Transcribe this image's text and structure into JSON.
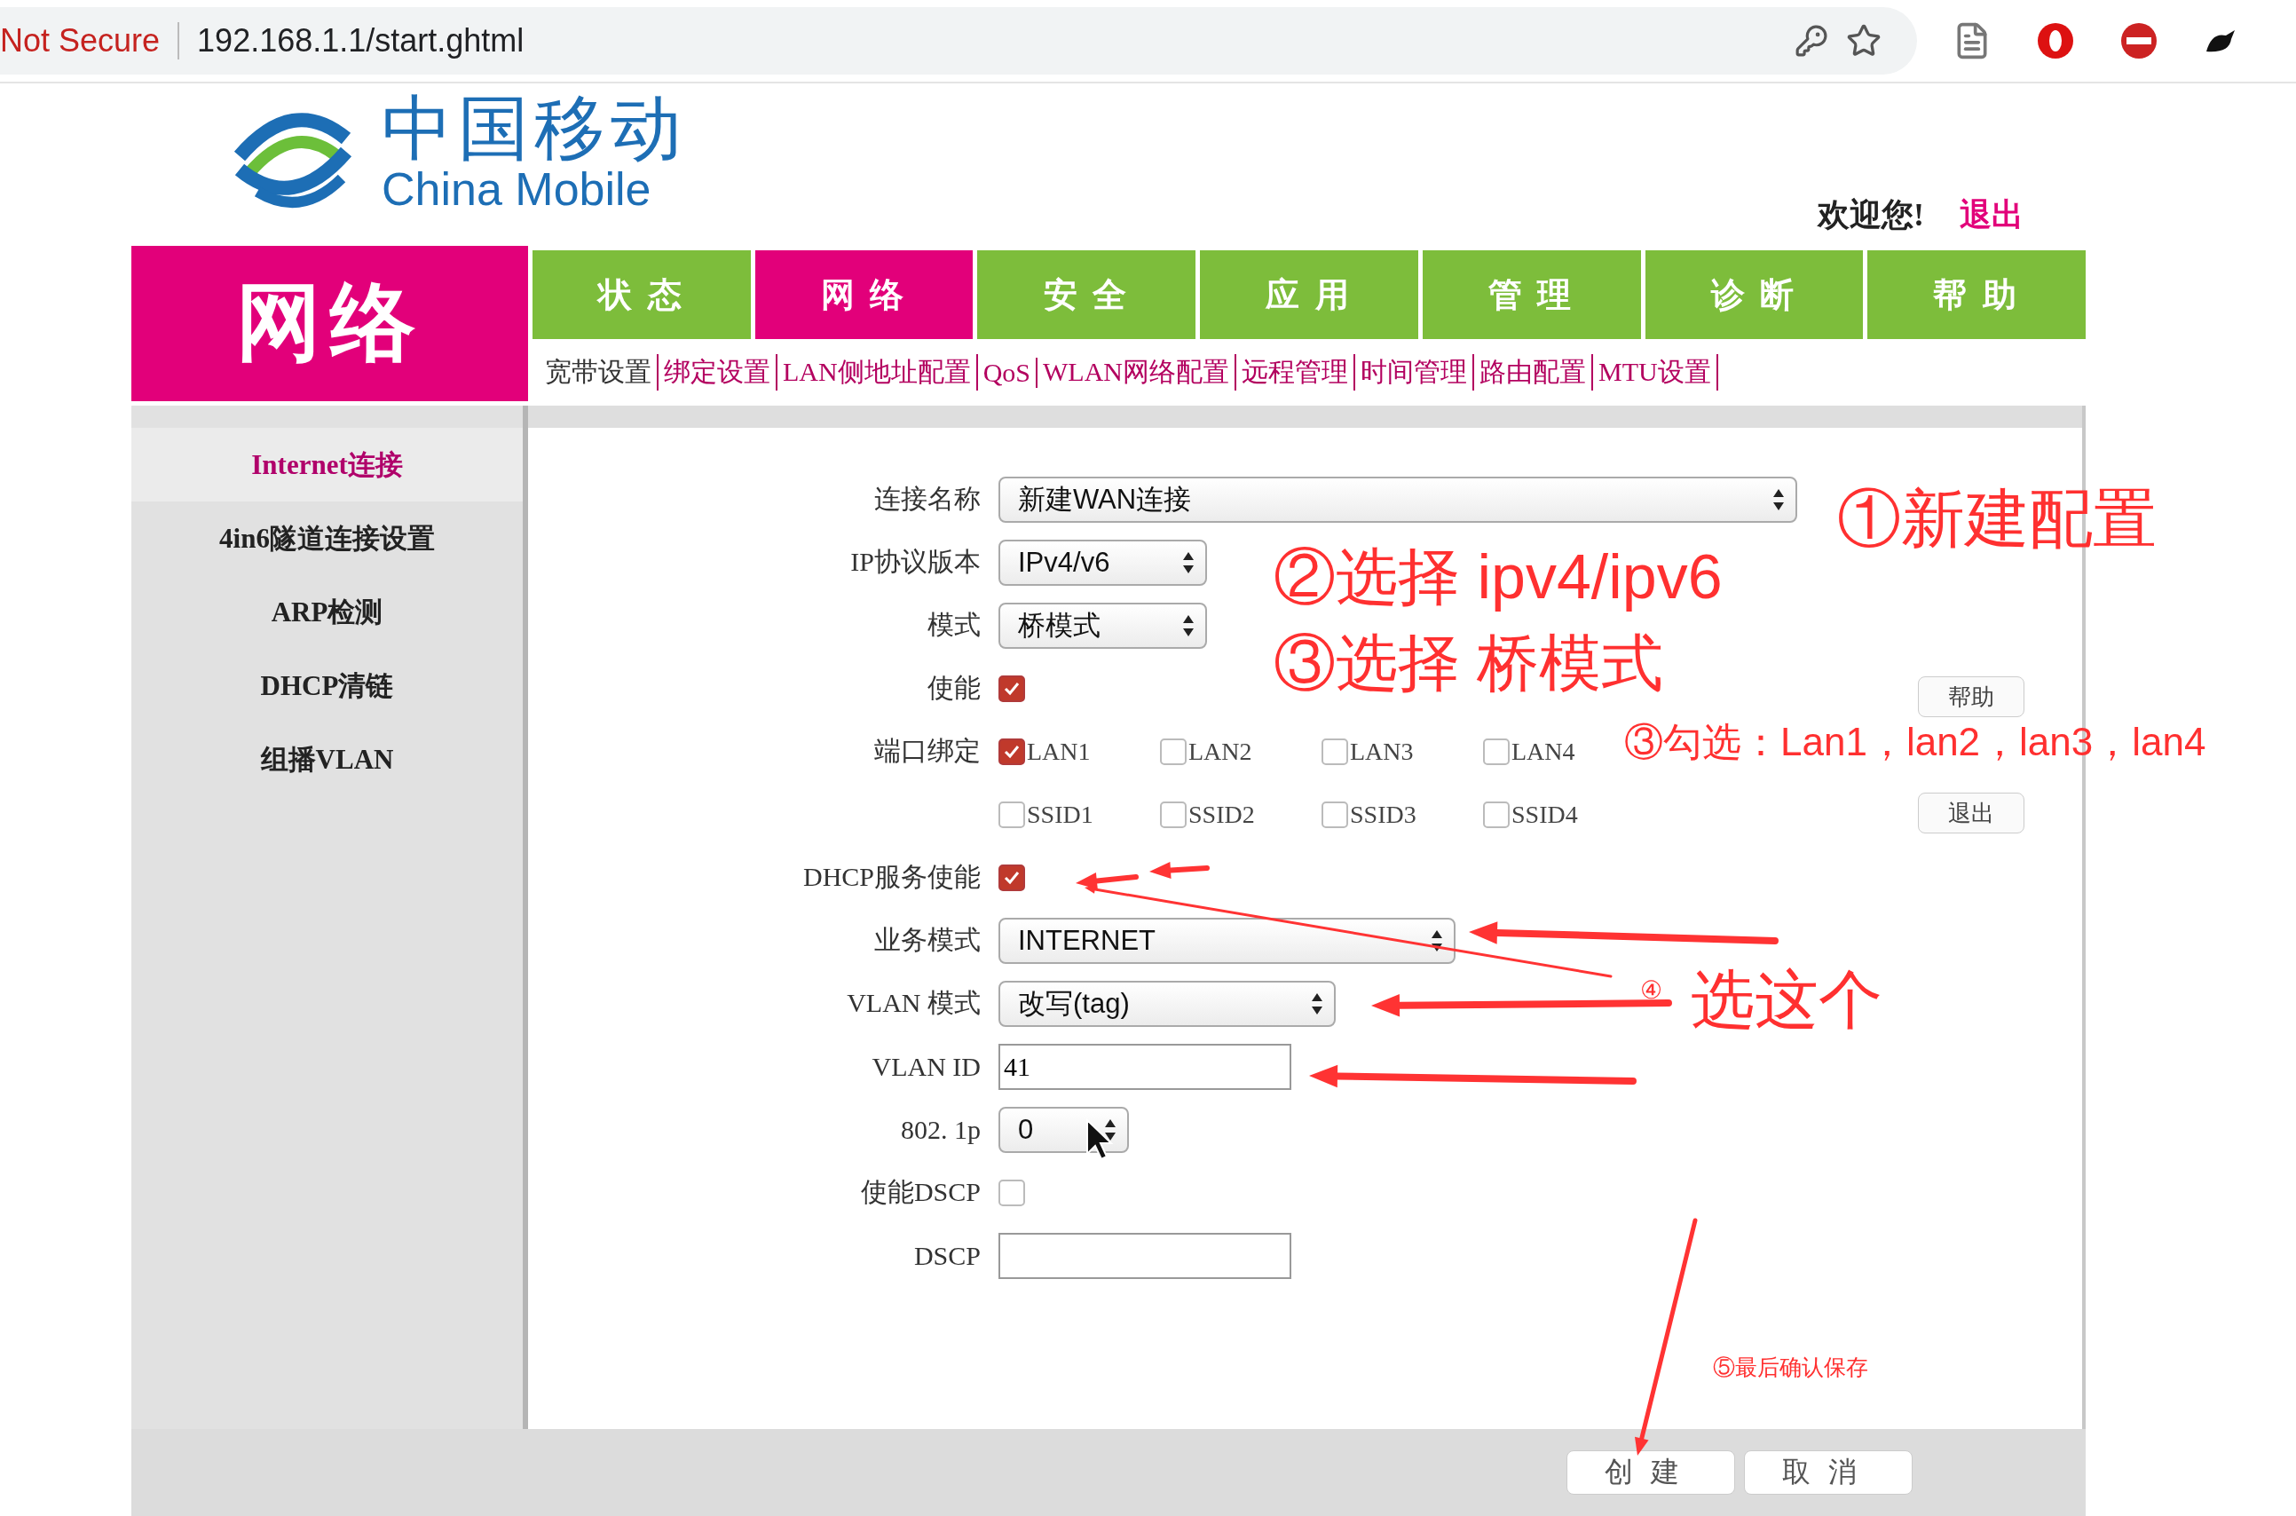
{
  "browser": {
    "security": "Not Secure",
    "url": "192.168.1.1/start.ghtml"
  },
  "logo": {
    "cn": "中国移动",
    "en": "China Mobile"
  },
  "welcome": {
    "text": "欢迎您!",
    "logout": "退出"
  },
  "section_title": "网络",
  "tabs": [
    {
      "label": "状 态",
      "selected": false
    },
    {
      "label": "网 络",
      "selected": true
    },
    {
      "label": "安 全",
      "selected": false
    },
    {
      "label": "应 用",
      "selected": false
    },
    {
      "label": "管 理",
      "selected": false
    },
    {
      "label": "诊 断",
      "selected": false
    },
    {
      "label": "帮 助",
      "selected": false
    }
  ],
  "submenu": [
    {
      "label": "宽带设置",
      "selected": true
    },
    {
      "label": "绑定设置",
      "selected": false
    },
    {
      "label": "LAN侧地址配置",
      "selected": false
    },
    {
      "label": "QoS",
      "selected": false
    },
    {
      "label": "WLAN网络配置",
      "selected": false
    },
    {
      "label": "远程管理",
      "selected": false
    },
    {
      "label": "时间管理",
      "selected": false
    },
    {
      "label": "路由配置",
      "selected": false
    },
    {
      "label": "MTU设置",
      "selected": false
    }
  ],
  "sidebar": [
    {
      "label": "Internet连接",
      "selected": true
    },
    {
      "label": "4in6隧道连接设置",
      "selected": false
    },
    {
      "label": "ARP检测",
      "selected": false
    },
    {
      "label": "DHCP清链",
      "selected": false
    },
    {
      "label": "组播VLAN",
      "selected": false
    }
  ],
  "form": [
    {
      "kind": "select-wide",
      "label": "连接名称",
      "value": "新建WAN连接"
    },
    {
      "kind": "select-short",
      "label": "IP协议版本",
      "value": "IPv4/v6"
    },
    {
      "kind": "select-short",
      "label": "模式",
      "value": "桥模式"
    },
    {
      "kind": "checkbox",
      "label": "使能",
      "checked": true
    },
    {
      "kind": "options",
      "label": "端口绑定",
      "options": [
        {
          "label": "LAN1",
          "checked": true
        },
        {
          "label": "LAN2",
          "checked": false
        },
        {
          "label": "LAN3",
          "checked": false
        },
        {
          "label": "LAN4",
          "checked": false
        }
      ]
    },
    {
      "kind": "options",
      "options": [
        {
          "label": "SSID1",
          "checked": false
        },
        {
          "label": "SSID2",
          "checked": false
        },
        {
          "label": "SSID3",
          "checked": false
        },
        {
          "label": "SSID4",
          "checked": false
        }
      ]
    },
    {
      "kind": "checkbox",
      "label": "DHCP服务使能",
      "checked": true
    },
    {
      "kind": "select-medium",
      "label": "业务模式",
      "value": "INTERNET"
    },
    {
      "kind": "select-mid",
      "label": "VLAN 模式",
      "value": "改写(tag)"
    },
    {
      "kind": "text",
      "label": "VLAN ID",
      "value": "41"
    },
    {
      "kind": "select-tiny",
      "label": "802. 1p",
      "value": "0"
    },
    {
      "kind": "checkbox",
      "label": "使能DSCP",
      "checked": false
    },
    {
      "kind": "text",
      "label": "DSCP"
    }
  ],
  "side_buttons": [
    "帮助",
    "退出"
  ],
  "footer_buttons": [
    "创建",
    "取消"
  ],
  "annotations": [
    "①新建配置",
    "②选择 ipv4/ipv6",
    "③选择 桥模式",
    "③勾选：Lan1，lan2，lan3，lan4",
    "④",
    "选这个",
    "⑤最后确认保存"
  ]
}
